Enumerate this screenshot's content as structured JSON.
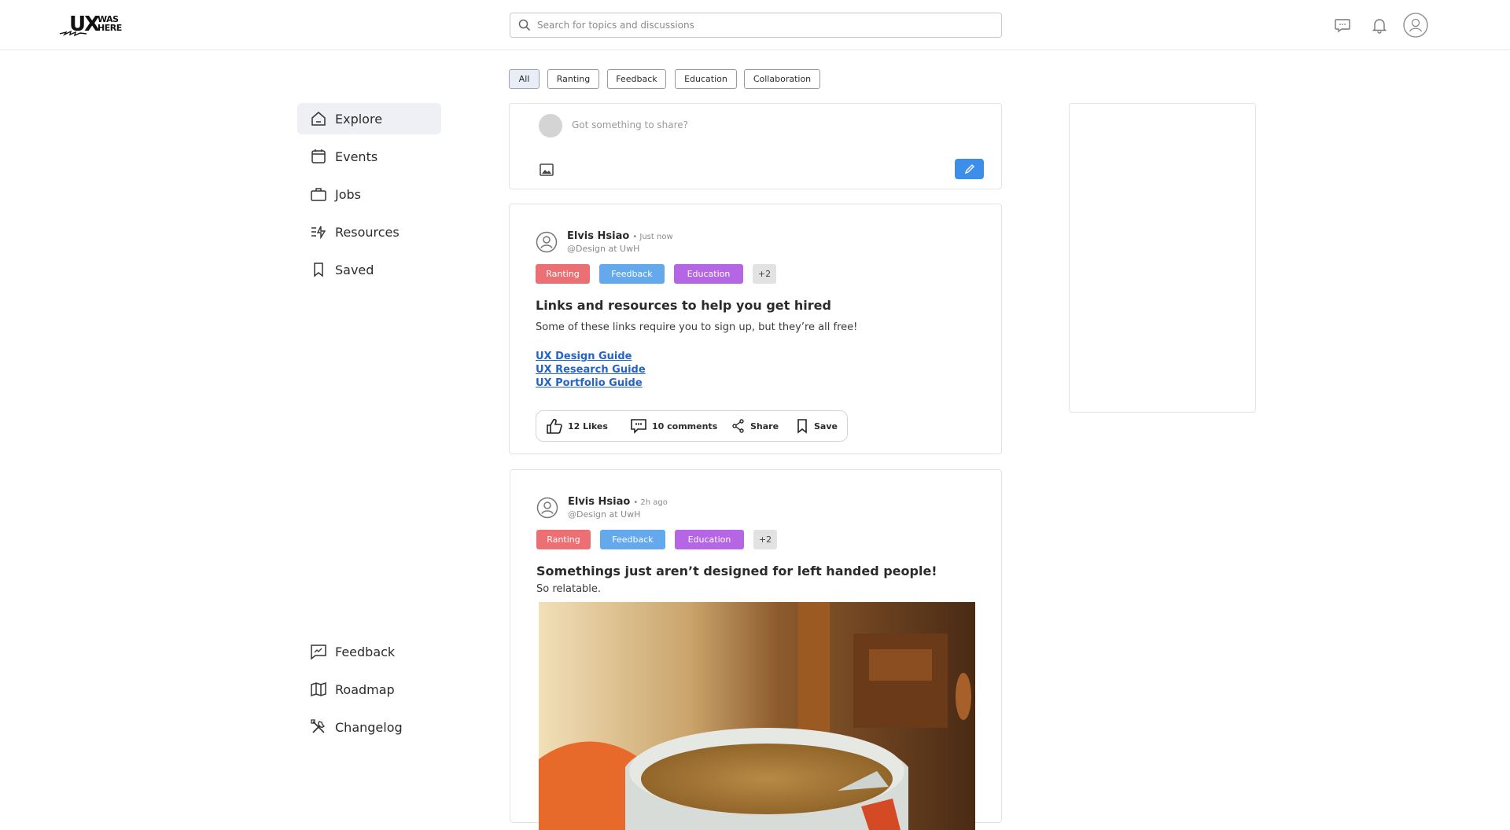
{
  "header": {
    "logo_ux": "UX",
    "logo_was": "WAS",
    "logo_here": "HERE",
    "search_placeholder": "Search for topics and discussions",
    "icons": [
      "chat-icon",
      "bell-icon",
      "user-icon"
    ]
  },
  "sidebar": {
    "top_items": [
      {
        "label": "Explore",
        "icon": "home-icon",
        "active": true
      },
      {
        "label": "Events",
        "icon": "calendar-icon",
        "active": false
      },
      {
        "label": "Jobs",
        "icon": "briefcase-icon",
        "active": false
      },
      {
        "label": "Resources",
        "icon": "resources-icon",
        "active": false
      },
      {
        "label": "Saved",
        "icon": "bookmark-icon",
        "active": false
      }
    ],
    "bottom_items": [
      {
        "label": "Feedback",
        "icon": "feedback-icon"
      },
      {
        "label": "Roadmap",
        "icon": "map-icon"
      },
      {
        "label": "Changelog",
        "icon": "tools-icon"
      }
    ]
  },
  "filters": {
    "chips": [
      "All",
      "Ranting",
      "Feedback",
      "Education",
      "Collaboration"
    ],
    "selected": "All"
  },
  "composer": {
    "placeholder": "Got something to share?"
  },
  "posts": [
    {
      "author": "Elvis Hsiao",
      "time": "• Just now",
      "handle": "@Design at UwH",
      "tags": [
        "Ranting",
        "Feedback",
        "Education",
        "+2"
      ],
      "title": "Links and resources to help you get hired",
      "body": "Some of these links require you to sign up, but they’re all free!",
      "links": [
        "UX Design Guide",
        "UX Research Guide",
        "UX Portfolio Guide"
      ],
      "actions": {
        "likes": "12 Likes",
        "comments": "10 comments",
        "share": "Share",
        "save": "Save"
      }
    },
    {
      "author": "Elvis Hsiao",
      "time": "• 2h ago",
      "handle": "@Design at UwH",
      "tags": [
        "Ranting",
        "Feedback",
        "Education",
        "+2"
      ],
      "title": "Somethings just aren’t designed for left handed people!",
      "body": "So relatable."
    }
  ],
  "colors": {
    "accent": "#3d8ee8",
    "ranting": "#ec6f73",
    "feedback": "#63a9ec",
    "education": "#b466e4",
    "link": "#2463c7"
  }
}
